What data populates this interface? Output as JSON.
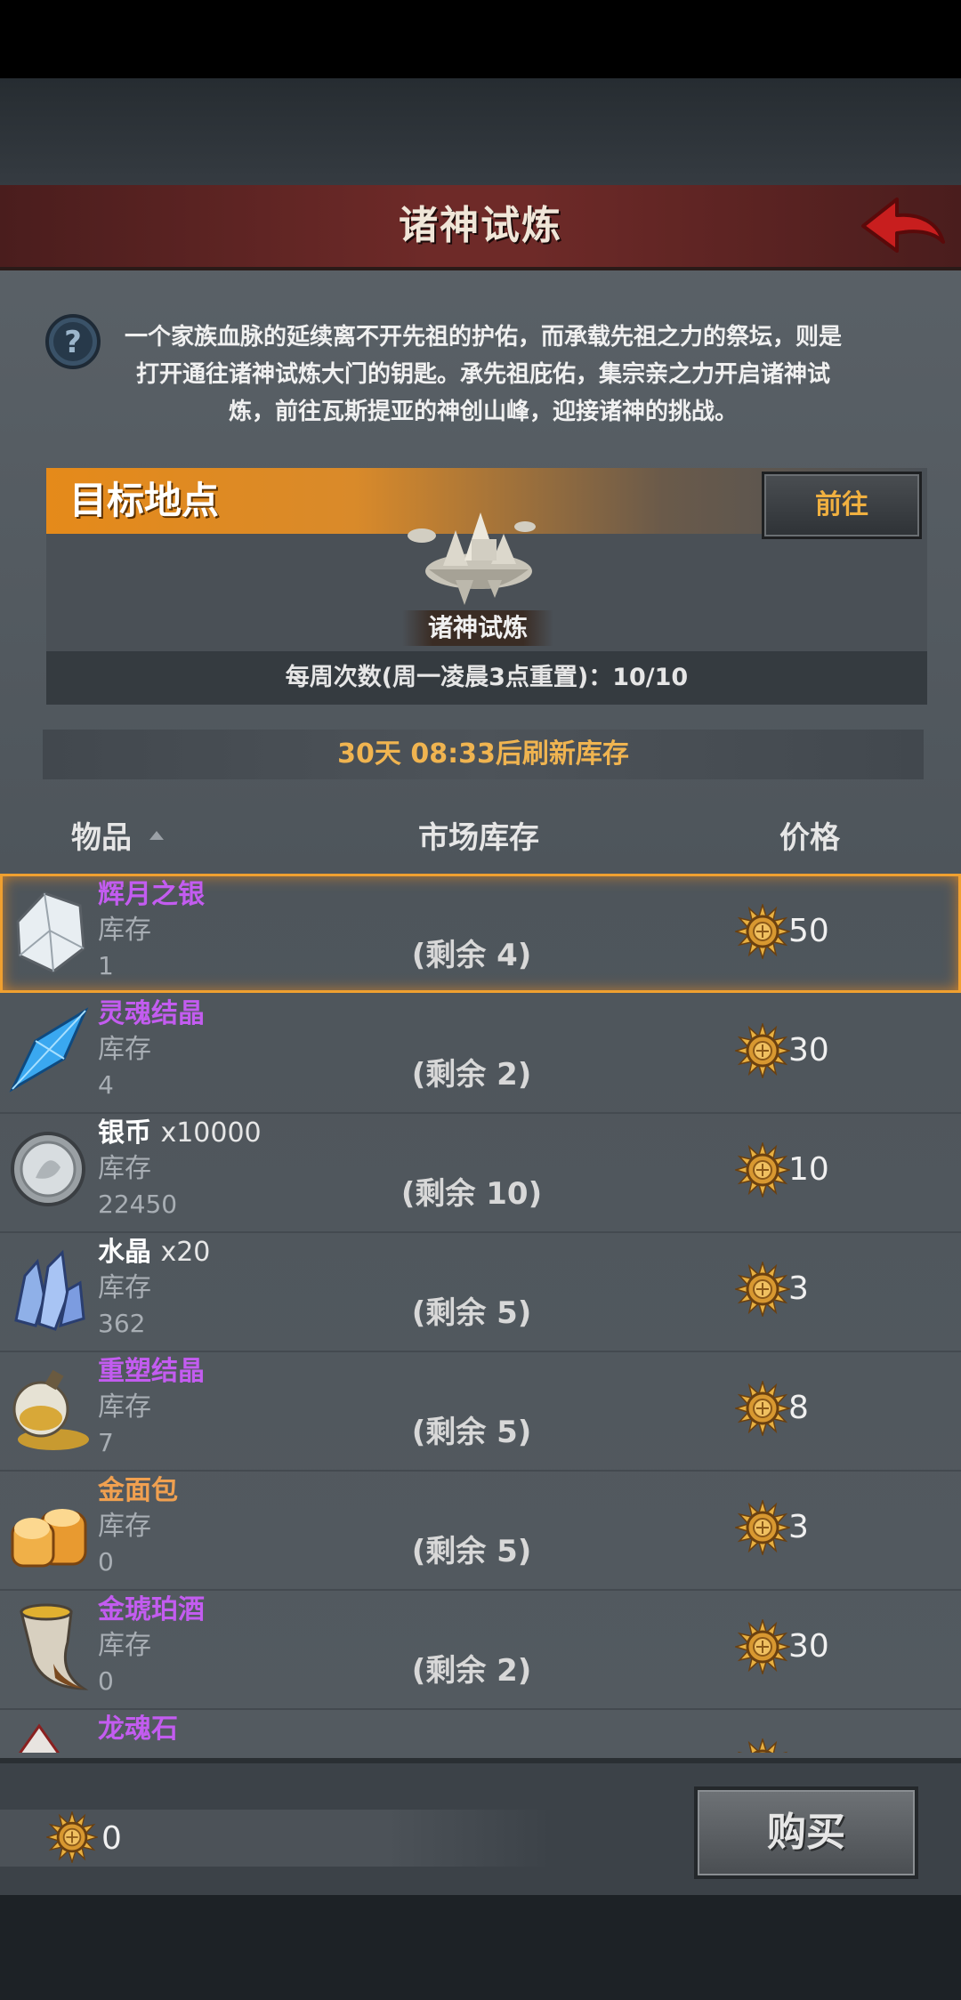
{
  "header": {
    "title": "诸神试炼"
  },
  "intro": {
    "text": "一个家族血脉的延续离不开先祖的护佑，而承载先祖之力的祭坛，则是打开通往诸神试炼大门的钥匙。承先祖庇佑，集宗亲之力开启诸神试炼，前往瓦斯提亚的神创山峰，迎接诸神的挑战。"
  },
  "target": {
    "title": "目标地点",
    "goto_label": "前往",
    "location_name": "诸神试炼",
    "weekly_text": "每周次数(周一凌晨3点重置)：10/10"
  },
  "refresh_text": "30天 08:33后刷新库存",
  "columns": {
    "item": "物品",
    "stock": "市场库存",
    "price": "价格"
  },
  "items": [
    {
      "name": "辉月之银",
      "qty": "",
      "name_color": "#c35cf0",
      "stock_label": "库存",
      "stock": "1",
      "remain": "(剩余 4)",
      "price": "50",
      "icon": "silver-ore-icon"
    },
    {
      "name": "灵魂结晶",
      "qty": "",
      "name_color": "#c35cf0",
      "stock_label": "库存",
      "stock": "4",
      "remain": "(剩余 2)",
      "price": "30",
      "icon": "soul-crystal-icon"
    },
    {
      "name": "银币",
      "qty": "x10000",
      "name_color": "#ffffff",
      "stock_label": "库存",
      "stock": "22450",
      "remain": "(剩余 10)",
      "price": "10",
      "icon": "silver-coin-icon"
    },
    {
      "name": "水晶",
      "qty": "x20",
      "name_color": "#ffffff",
      "stock_label": "库存",
      "stock": "362",
      "remain": "(剩余 5)",
      "price": "3",
      "icon": "crystal-icon"
    },
    {
      "name": "重塑结晶",
      "qty": "",
      "name_color": "#c35cf0",
      "stock_label": "库存",
      "stock": "7",
      "remain": "(剩余 5)",
      "price": "8",
      "icon": "reshape-crystal-icon"
    },
    {
      "name": "金面包",
      "qty": "",
      "name_color": "#f0a050",
      "stock_label": "库存",
      "stock": "0",
      "remain": "(剩余 5)",
      "price": "3",
      "icon": "golden-bread-icon"
    },
    {
      "name": "金琥珀酒",
      "qty": "",
      "name_color": "#c35cf0",
      "stock_label": "库存",
      "stock": "0",
      "remain": "(剩余 2)",
      "price": "30",
      "icon": "amber-wine-horn-icon"
    },
    {
      "name": "龙魂石",
      "qty": "",
      "name_color": "#c35cf0",
      "stock_label": "",
      "stock": "",
      "remain": "",
      "price": "",
      "icon": "dragon-soul-stone-icon"
    }
  ],
  "wallet": {
    "amount": "0"
  },
  "buy_label": "购买"
}
